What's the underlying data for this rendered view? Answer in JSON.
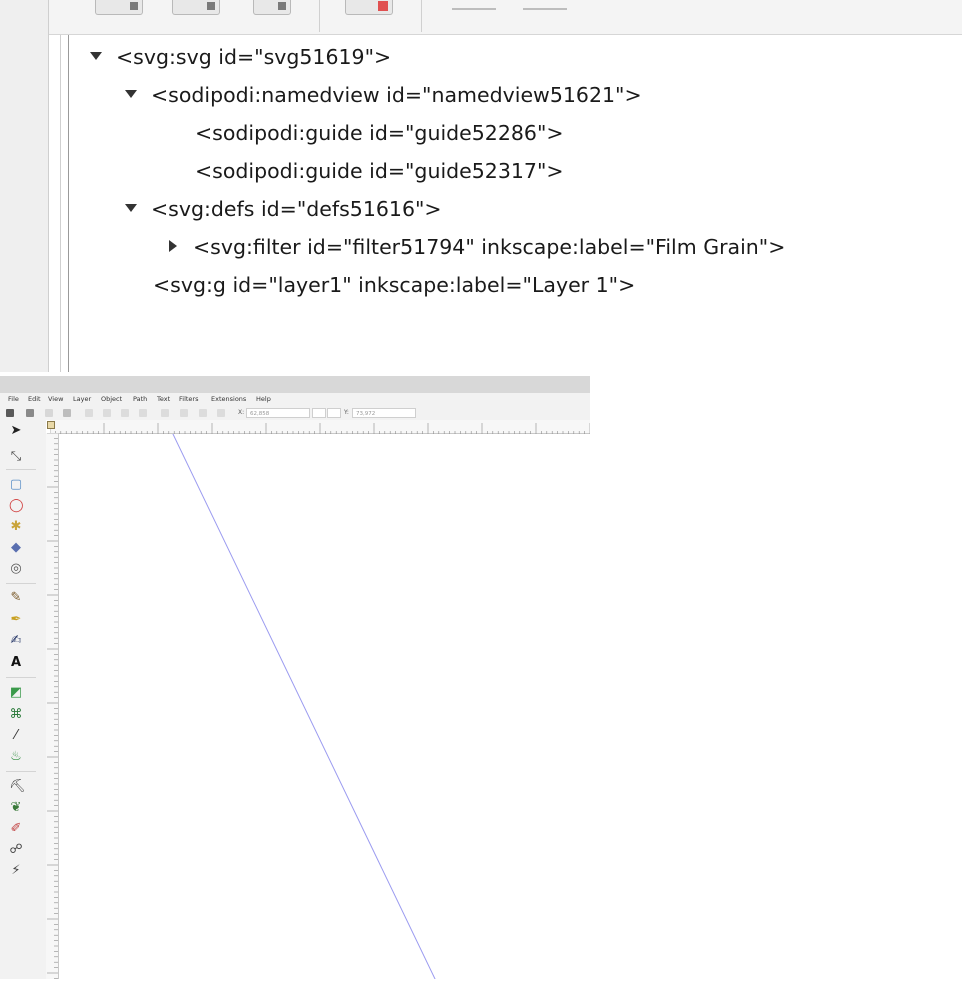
{
  "xml_editor": {
    "nodes": [
      {
        "text": "<svg:svg id=\"svg51619\">",
        "expander": "expanded"
      },
      {
        "text": "<sodipodi:namedview id=\"namedview51621\">",
        "expander": "expanded"
      },
      {
        "text": "<sodipodi:guide id=\"guide52286\">",
        "expander": "none"
      },
      {
        "text": "<sodipodi:guide id=\"guide52317\">",
        "expander": "none"
      },
      {
        "text": "<svg:defs id=\"defs51616\">",
        "expander": "expanded"
      },
      {
        "text": "<svg:filter id=\"filter51794\" inkscape:label=\"Film Grain\">",
        "expander": "collapsed"
      },
      {
        "text": "<svg:g id=\"layer1\" inkscape:label=\"Layer 1\">",
        "expander": "none"
      }
    ]
  },
  "inkscape": {
    "menu": [
      "File",
      "Edit",
      "View",
      "Layer",
      "Object",
      "Path",
      "Text",
      "Filters",
      "Extensions",
      "Help"
    ],
    "x_label": "X:",
    "x_value": "62,858",
    "y_label": "Y:",
    "y_value": "73,972",
    "guide_color": "#9b9bf0"
  }
}
